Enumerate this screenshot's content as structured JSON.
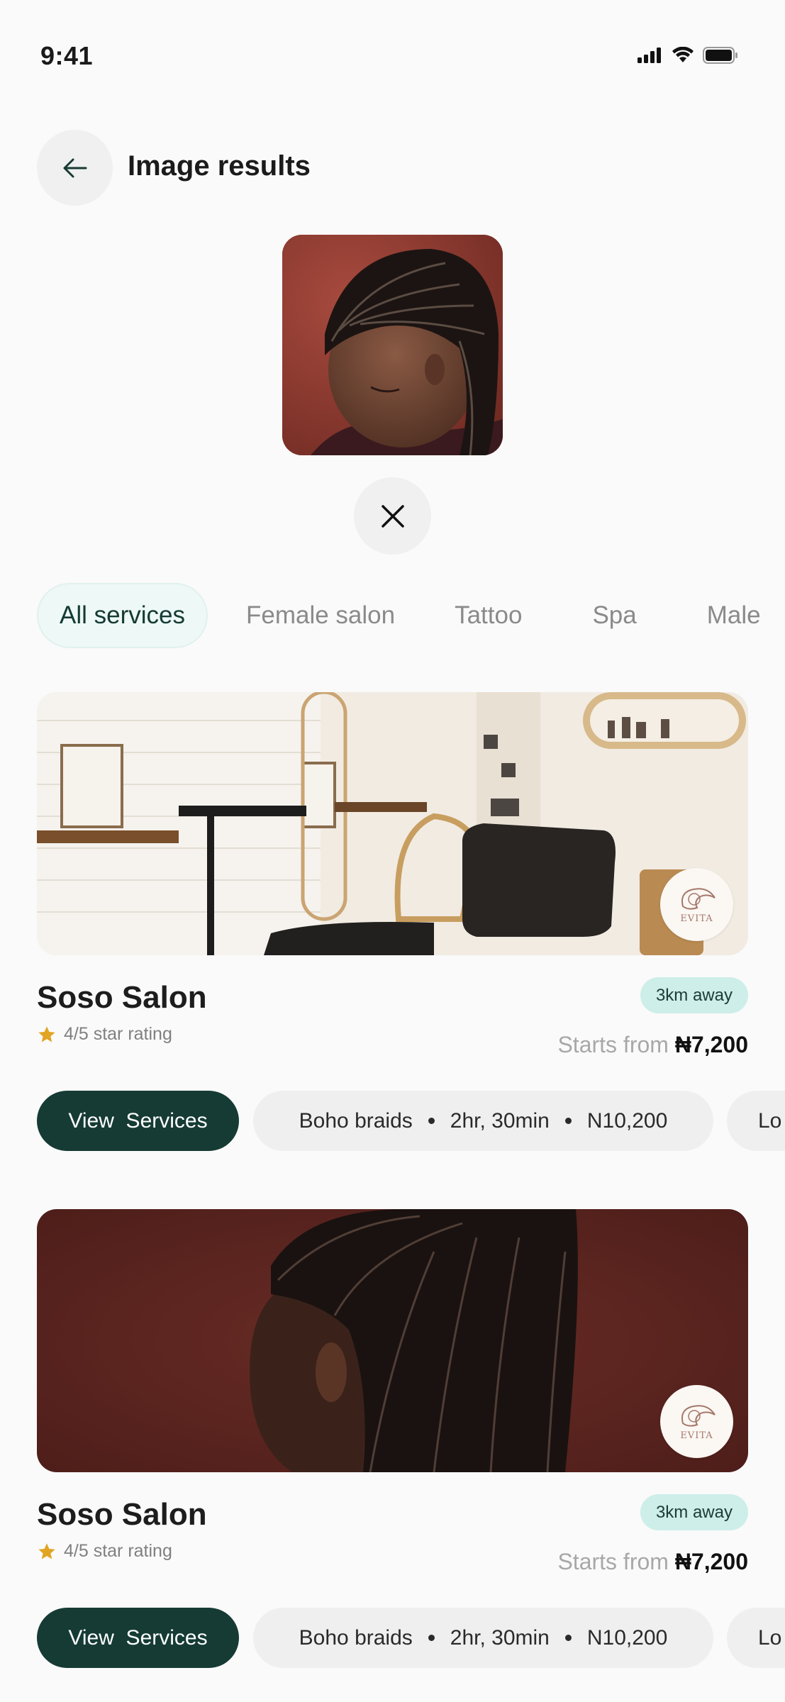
{
  "status_bar": {
    "time": "9:41"
  },
  "header": {
    "title": "Image results"
  },
  "tabs": [
    {
      "label": "All services",
      "active": true
    },
    {
      "label": "Female salon",
      "active": false
    },
    {
      "label": "Tattoo",
      "active": false
    },
    {
      "label": "Spa",
      "active": false
    },
    {
      "label": "Male",
      "active": false
    }
  ],
  "cards": [
    {
      "name": "Soso Salon",
      "rating": "4/5 star rating",
      "distance": "3km away",
      "price_prefix": "Starts from",
      "price": "₦7,200",
      "logo_text": "EVITA",
      "view_button": "View  Services",
      "service": {
        "name": "Boho braids",
        "duration": "2hr, 30min",
        "price": "N10,200"
      },
      "next_service_label": "Lo"
    },
    {
      "name": "Soso Salon",
      "rating": "4/5 star rating",
      "distance": "3km away",
      "price_prefix": "Starts from",
      "price": "₦7,200",
      "logo_text": "EVITA",
      "view_button": "View  Services",
      "service": {
        "name": "Boho braids",
        "duration": "2hr, 30min",
        "price": "N10,200"
      },
      "next_service_label": "Lo"
    }
  ],
  "colors": {
    "primary": "#153b34",
    "badge_bg": "#cdeee9",
    "tab_active_bg": "#eef8f6",
    "star": "#e2a423"
  },
  "icons": [
    "back-arrow-icon",
    "close-icon",
    "star-icon",
    "signal-icon",
    "wifi-icon",
    "battery-icon"
  ]
}
